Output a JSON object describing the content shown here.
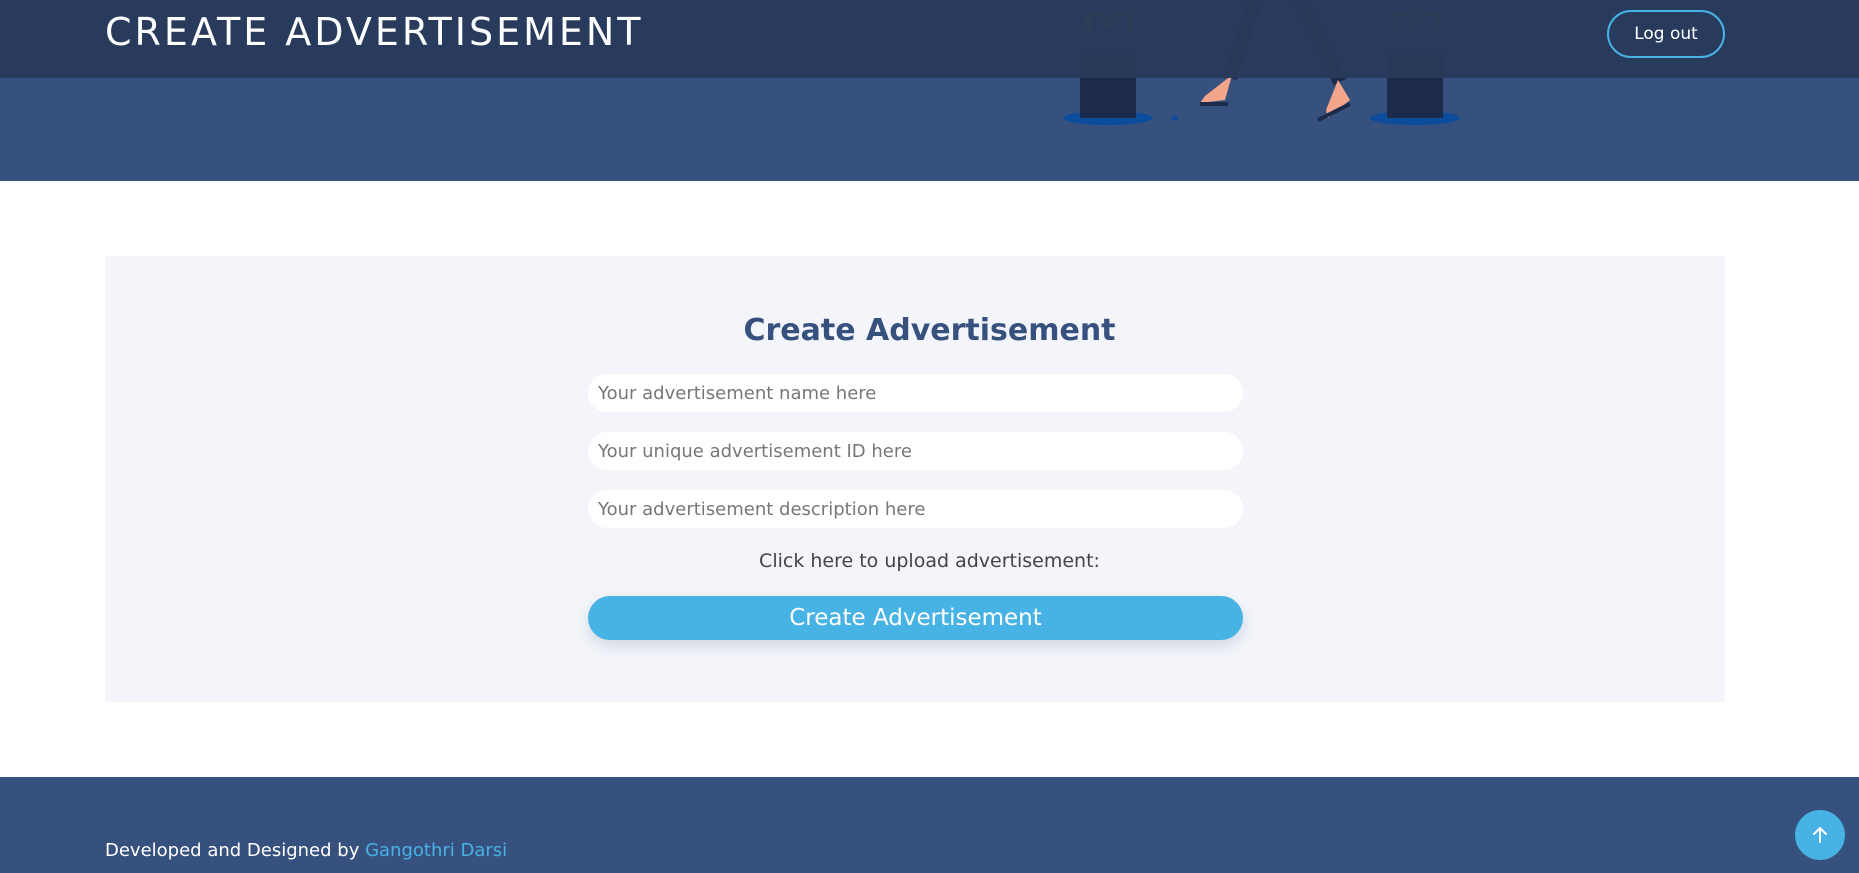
{
  "header": {
    "title": "CREATE ADVERTISEMENT",
    "logout_label": "Log out"
  },
  "form": {
    "heading": "Create Advertisement",
    "name_placeholder": "Your advertisement name here",
    "id_placeholder": "Your unique advertisement ID here",
    "description_placeholder": "Your advertisement description here",
    "upload_label": "Click here to upload advertisement:",
    "submit_label": "Create Advertisement"
  },
  "footer": {
    "credit_prefix": "Developed and Designed by ",
    "credit_name": "Gangothri Darsi"
  },
  "icons": {
    "back_to_top": "arrow-up-icon"
  },
  "colors": {
    "primary": "#37517e",
    "accent": "#47b2e4",
    "section_bg": "#f3f5fa"
  }
}
